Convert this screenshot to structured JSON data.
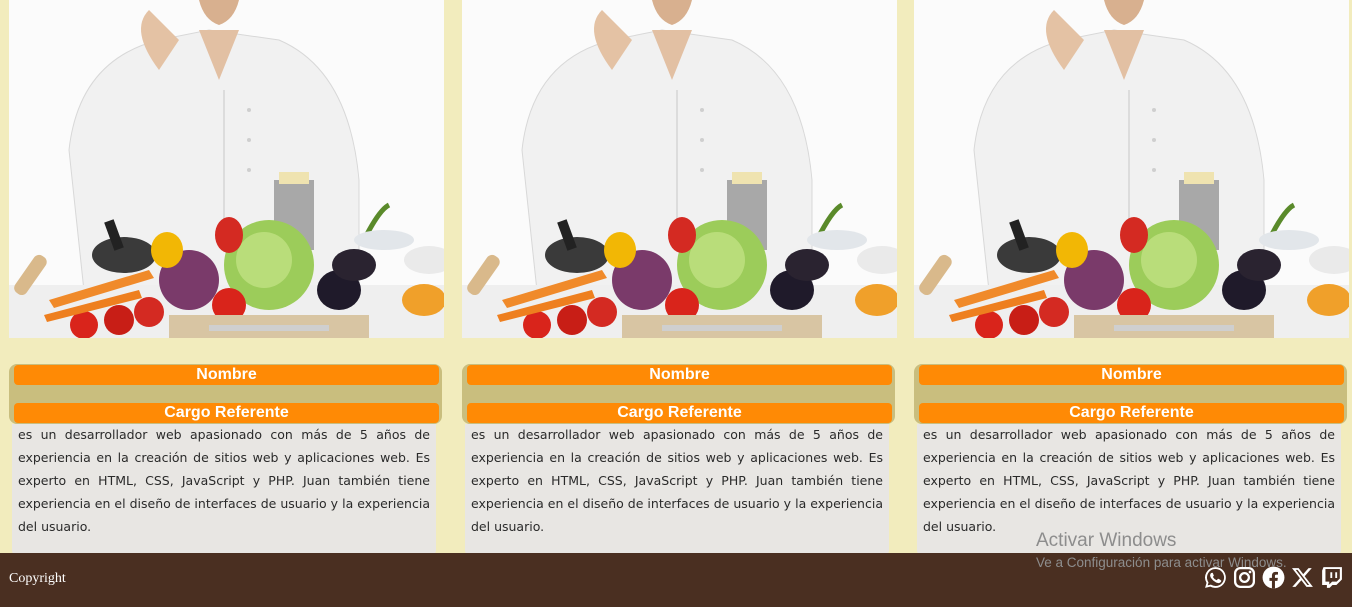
{
  "cards": [
    {
      "image_label": "chef-with-vegetables",
      "name": "Nombre",
      "role": "Cargo Referente",
      "description": "es un desarrollador web apasionado con más de 5 años de experiencia en la creación de sitios web y aplicaciones web. Es experto en HTML, CSS, JavaScript y PHP. Juan también tiene experiencia en el diseño de interfaces de usuario y la experiencia del usuario."
    },
    {
      "image_label": "chef-with-vegetables",
      "name": "Nombre",
      "role": "Cargo Referente",
      "description": "es un desarrollador web apasionado con más de 5 años de experiencia en la creación de sitios web y aplicaciones web. Es experto en HTML, CSS, JavaScript y PHP. Juan también tiene experiencia en el diseño de interfaces de usuario y la experiencia del usuario."
    },
    {
      "image_label": "chef-with-vegetables",
      "name": "Nombre",
      "role": "Cargo Referente",
      "description": "es un desarrollador web apasionado con más de 5 años de experiencia en la creación de sitios web y aplicaciones web. Es experto en HTML, CSS, JavaScript y PHP. Juan también tiene experiencia en el diseño de interfaces de usuario y la experiencia del usuario."
    }
  ],
  "footer": {
    "copyright": "Copyright",
    "social_icons": [
      "whatsapp-icon",
      "instagram-icon",
      "facebook-icon",
      "x-icon",
      "twitch-icon"
    ]
  },
  "os_watermark": {
    "title": "Activar Windows",
    "subtitle": "Ve a Configuración para activar Windows."
  },
  "colors": {
    "page_background": "#f2ecbd",
    "accent_orange": "#ff8a05",
    "panel_khaki": "#c9be7e",
    "description_background": "#e8e6e3",
    "footer_brown": "#4a2f21"
  }
}
